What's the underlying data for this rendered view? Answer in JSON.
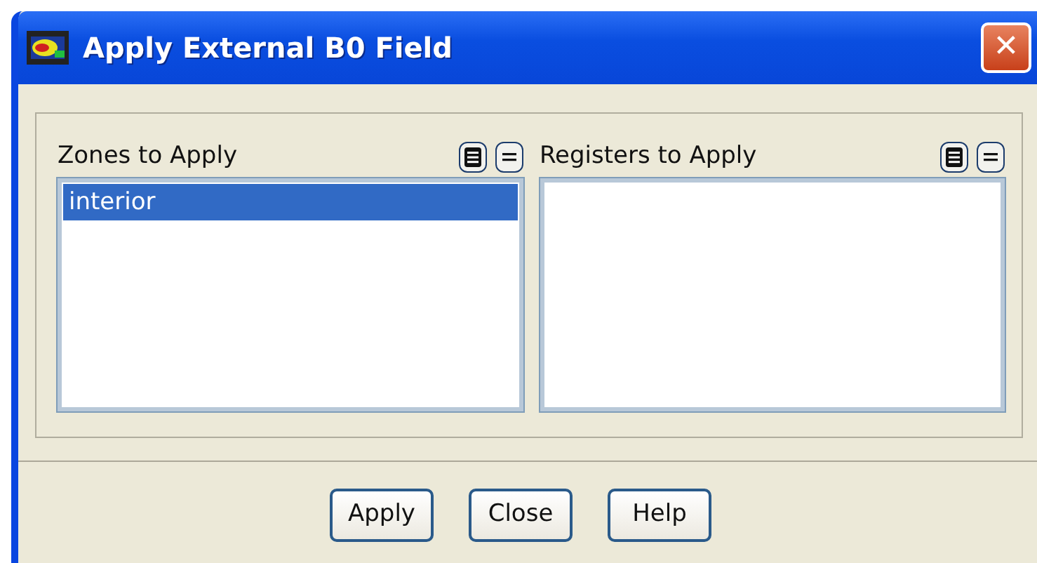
{
  "window": {
    "title": "Apply External B0 Field",
    "close": "✕"
  },
  "lists": [
    {
      "label": "Zones to Apply",
      "items": [
        {
          "text": "interior",
          "selected": true
        }
      ]
    },
    {
      "label": "Registers to Apply"
    }
  ],
  "buttons": [
    "Apply",
    "Close",
    "Help"
  ]
}
